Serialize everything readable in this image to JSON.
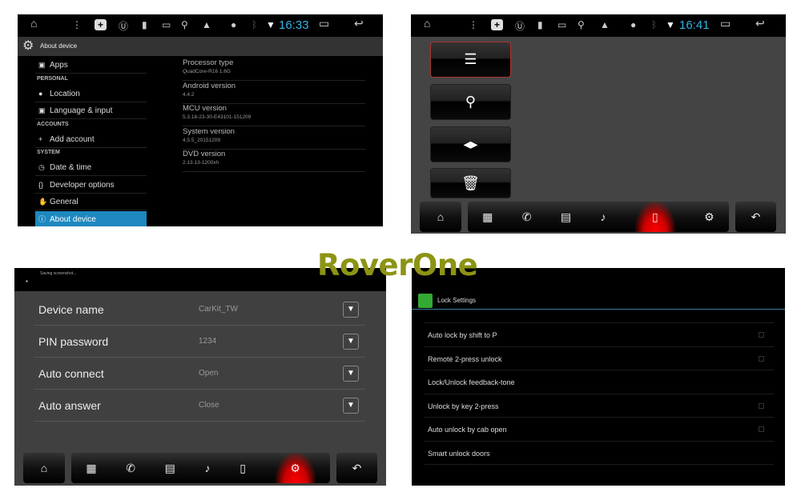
{
  "logo": "RoverOne",
  "colors": {
    "accent_blue": "#35b3e5",
    "selected_bg": "#1e88c0",
    "active_red": "#e00000",
    "logo": "#8c9414"
  },
  "about": {
    "time": "16:33",
    "title": "About device",
    "sidebar": [
      {
        "type": "item",
        "icon": "apps-icon",
        "label": "Apps"
      },
      {
        "type": "header",
        "label": "PERSONAL"
      },
      {
        "type": "item",
        "icon": "location-icon",
        "label": "Location"
      },
      {
        "type": "item",
        "icon": "language-icon",
        "label": "Language & input"
      },
      {
        "type": "header",
        "label": "ACCOUNTS"
      },
      {
        "type": "item",
        "icon": "plus-icon",
        "label": "Add account"
      },
      {
        "type": "header",
        "label": "SYSTEM"
      },
      {
        "type": "item",
        "icon": "clock-icon",
        "label": "Date & time"
      },
      {
        "type": "item",
        "icon": "braces-icon",
        "label": "Developer options"
      },
      {
        "type": "item",
        "icon": "hand-icon",
        "label": "General"
      },
      {
        "type": "item",
        "icon": "info-icon",
        "label": "About device",
        "selected": true
      }
    ],
    "info": [
      {
        "k": "Processor type",
        "v": "QuadCore-R16 1.6G"
      },
      {
        "k": "Android version",
        "v": "4.4.2"
      },
      {
        "k": "MCU version",
        "v": "5.3.18-23-30-E43101-151209"
      },
      {
        "k": "System version",
        "v": "4.5.5_20151209"
      },
      {
        "k": "DVD version",
        "v": "2.13.13-1200xh"
      }
    ]
  },
  "phone": {
    "time": "16:41",
    "side_buttons": [
      "list-icon",
      "search-icon",
      "connect-icon",
      "trash-icon"
    ],
    "active_tab": "bluetooth-phone-icon"
  },
  "bt": {
    "status": "Saving screenshot...",
    "rows": [
      {
        "label": "Device name",
        "value": "CarKit_TW"
      },
      {
        "label": "PIN password",
        "value": "1234"
      },
      {
        "label": "Auto connect",
        "value": "Open"
      },
      {
        "label": "Auto answer",
        "value": "Close"
      }
    ],
    "active_tab": "settings-icon"
  },
  "lock": {
    "title": "Lock Settings",
    "items": [
      {
        "label": "Auto lock by shift to P",
        "checkbox": true
      },
      {
        "label": "Remote 2-press unlock",
        "checkbox": true
      },
      {
        "label": "Lock/Unlock feedback-tone",
        "checkbox": false
      },
      {
        "label": "Unlock by key 2-press",
        "checkbox": true
      },
      {
        "label": "Auto unlock by cab open",
        "checkbox": true
      },
      {
        "label": "Smart unlock doors",
        "checkbox": false
      }
    ]
  }
}
